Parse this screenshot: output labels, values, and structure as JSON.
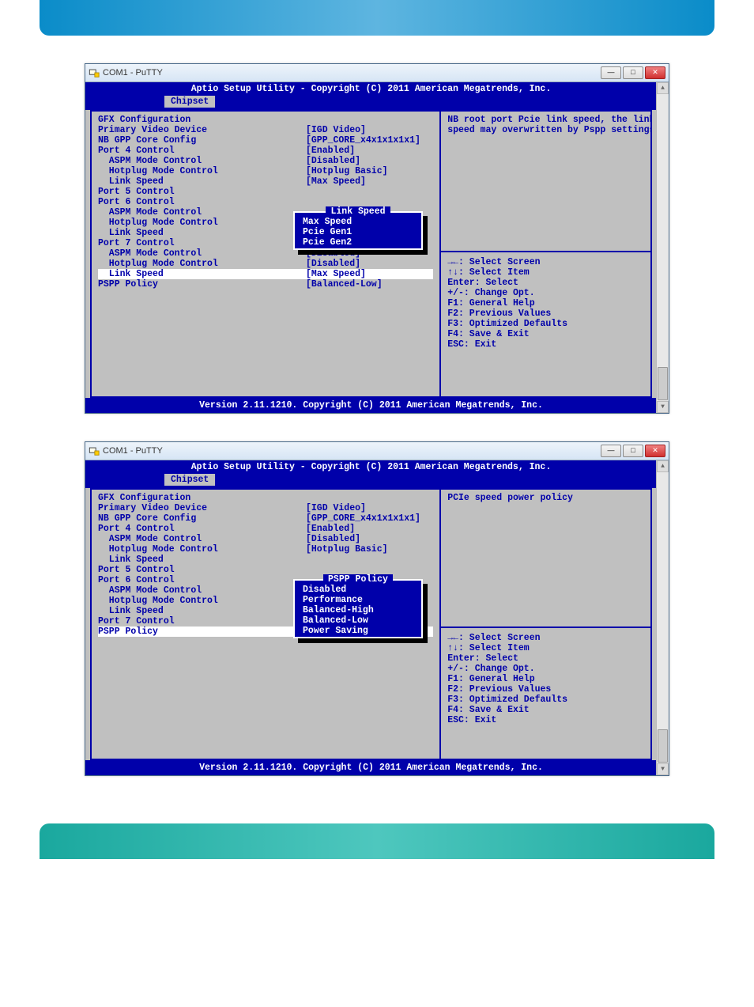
{
  "window_title": "COM1 - PuTTY",
  "bios_header": "Aptio Setup Utility - Copyright (C) 2011 American Megatrends, Inc.",
  "bios_tab": "Chipset",
  "bios_footer": "Version 2.11.1210. Copyright (C) 2011 American Megatrends, Inc.",
  "hints": [
    "→←: Select Screen",
    "↑↓: Select Item",
    "Enter: Select",
    "+/-: Change Opt.",
    "F1: General Help",
    "F2: Previous Values",
    "F3: Optimized Defaults",
    "F4: Save & Exit",
    "ESC: Exit"
  ],
  "screen1": {
    "help": "NB root port Pcie link speed, the link speed may overwritten by Pspp settings",
    "rows": [
      {
        "label": "GFX Configuration",
        "value": ""
      },
      {
        "label": "",
        "value": ""
      },
      {
        "label": "Primary Video Device",
        "value": "[IGD Video]"
      },
      {
        "label": "",
        "value": ""
      },
      {
        "label": "NB GPP Core Config",
        "value": "[GPP_CORE_x4x1x1x1x1]"
      },
      {
        "label": "",
        "value": ""
      },
      {
        "label": "Port 4 Control",
        "value": "[Enabled]"
      },
      {
        "label": "  ASPM Mode Control",
        "value": "[Disabled]"
      },
      {
        "label": "  Hotplug Mode Control",
        "value": "[Hotplug Basic]"
      },
      {
        "label": "  Link Speed",
        "value": "[Max Speed]"
      },
      {
        "label": "Port 5 Control",
        "value": ""
      },
      {
        "label": "Port 6 Control",
        "value": ""
      },
      {
        "label": "  ASPM Mode Control",
        "value": ""
      },
      {
        "label": "  Hotplug Mode Control",
        "value": ""
      },
      {
        "label": "  Link Speed",
        "value": ""
      },
      {
        "label": "Port 7 Control",
        "value": ""
      },
      {
        "label": "  ASPM Mode Control",
        "value": "[Disabled]"
      },
      {
        "label": "  Hotplug Mode Control",
        "value": "[Disabled]"
      },
      {
        "label": "  Link Speed",
        "value": "[Max Speed]",
        "hl": true
      },
      {
        "label": "PSPP Policy",
        "value": "[Balanced-Low]"
      }
    ],
    "popup": {
      "title": "Link Speed",
      "items": [
        "Max Speed",
        "Pcie Gen1",
        "Pcie Gen2"
      ],
      "selected": 0
    }
  },
  "screen2": {
    "help": "PCIe speed power policy",
    "rows": [
      {
        "label": "GFX Configuration",
        "value": ""
      },
      {
        "label": "",
        "value": ""
      },
      {
        "label": "Primary Video Device",
        "value": "[IGD Video]"
      },
      {
        "label": "",
        "value": ""
      },
      {
        "label": "NB GPP Core Config",
        "value": "[GPP_CORE_x4x1x1x1x1]"
      },
      {
        "label": "",
        "value": ""
      },
      {
        "label": "Port 4 Control",
        "value": "[Enabled]"
      },
      {
        "label": "  ASPM Mode Control",
        "value": "[Disabled]"
      },
      {
        "label": "  Hotplug Mode Control",
        "value": "[Hotplug Basic]"
      },
      {
        "label": "  Link Speed",
        "value": ""
      },
      {
        "label": "Port 5 Control",
        "value": ""
      },
      {
        "label": "Port 6 Control",
        "value": ""
      },
      {
        "label": "  ASPM Mode Control",
        "value": ""
      },
      {
        "label": "  Hotplug Mode Control",
        "value": ""
      },
      {
        "label": "  Link Speed",
        "value": ""
      },
      {
        "label": "Port 7 Control",
        "value": ""
      },
      {
        "label": "PSPP Policy",
        "value": "[",
        "hl": true
      }
    ],
    "popup": {
      "title": "PSPP Policy",
      "items": [
        "Disabled",
        "Performance",
        "Balanced-High",
        "Balanced-Low",
        "Power Saving"
      ],
      "selected": 3
    }
  }
}
